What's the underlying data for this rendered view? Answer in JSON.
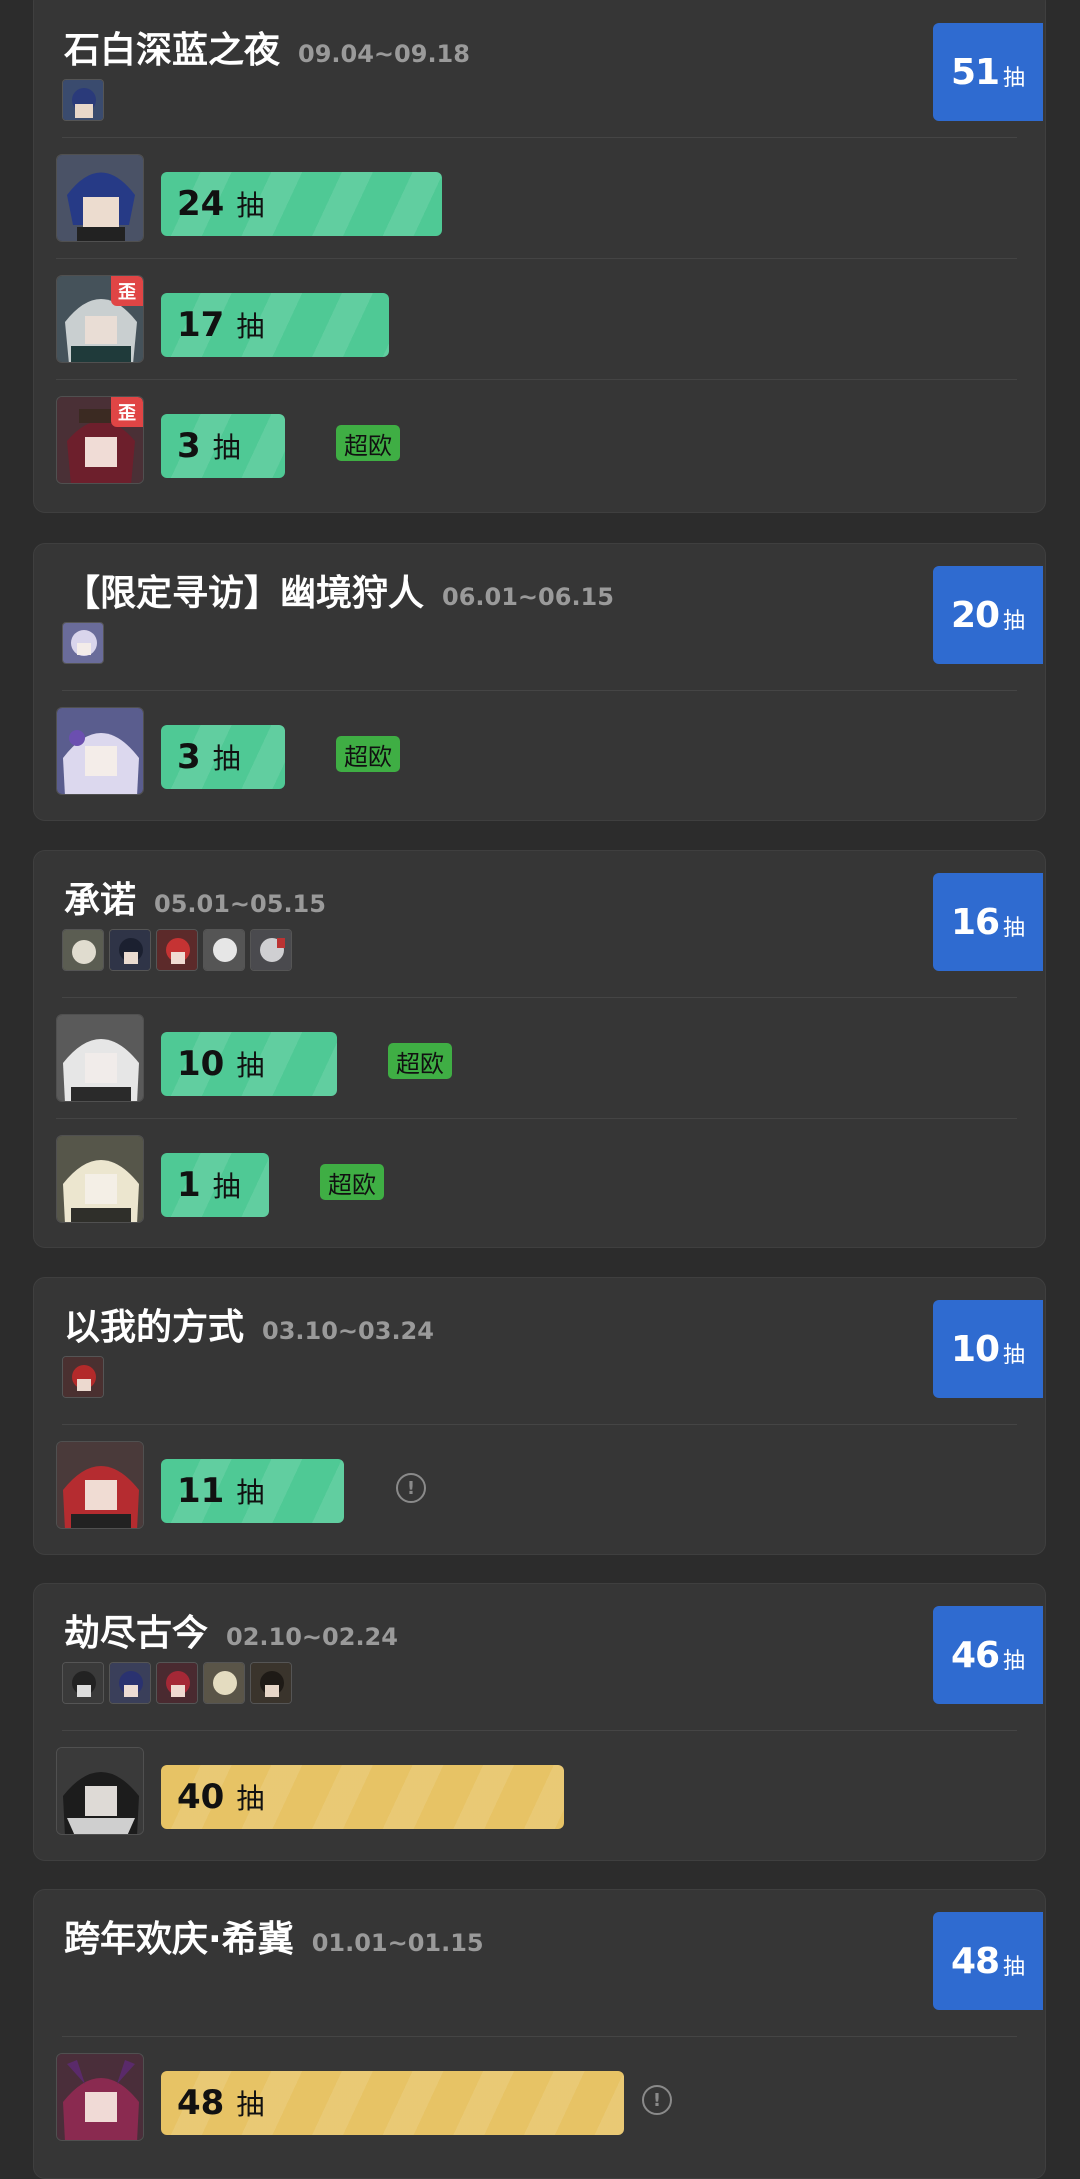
{
  "colors": {
    "background": "#2c2c2c",
    "card": "#363636",
    "badge_blue": "#2f6bd0",
    "bar_green": "#4fc995",
    "bar_yellow": "#e7c365",
    "lucky_green": "#3fae44",
    "wai_red": "#e04545"
  },
  "banners": [
    {
      "title": "石白深蓝之夜",
      "date": "09.04~09.18",
      "total_num": "51",
      "total_unit": "抽",
      "pulls": [
        {
          "num": "24",
          "unit": "抽",
          "wai": false,
          "tag": ""
        },
        {
          "num": "17",
          "unit": "抽",
          "wai": true,
          "wai_label": "歪",
          "tag": ""
        },
        {
          "num": "3",
          "unit": "抽",
          "wai": true,
          "wai_label": "歪",
          "tag": "超欧"
        }
      ]
    },
    {
      "title": "【限定寻访】幽境狩人",
      "date": "06.01~06.15",
      "total_num": "20",
      "total_unit": "抽",
      "pulls": [
        {
          "num": "3",
          "unit": "抽",
          "wai": false,
          "tag": "超欧"
        }
      ]
    },
    {
      "title": "承诺",
      "date": "05.01~05.15",
      "total_num": "16",
      "total_unit": "抽",
      "pulls": [
        {
          "num": "10",
          "unit": "抽",
          "wai": false,
          "tag": "超欧"
        },
        {
          "num": "1",
          "unit": "抽",
          "wai": false,
          "tag": "超欧"
        }
      ]
    },
    {
      "title": "以我的方式",
      "date": "03.10~03.24",
      "total_num": "10",
      "total_unit": "抽",
      "pulls": [
        {
          "num": "11",
          "unit": "抽",
          "wai": false,
          "tag": "",
          "info": "!"
        }
      ]
    },
    {
      "title": "劫尽古今",
      "date": "02.10~02.24",
      "total_num": "46",
      "total_unit": "抽",
      "pulls": [
        {
          "num": "40",
          "unit": "抽",
          "wai": false,
          "tag": ""
        }
      ]
    },
    {
      "title": "跨年欢庆·希冀",
      "date": "01.01~01.15",
      "total_num": "48",
      "total_unit": "抽",
      "pulls": [
        {
          "num": "48",
          "unit": "抽",
          "wai": false,
          "tag": "",
          "info": "!"
        }
      ]
    }
  ]
}
